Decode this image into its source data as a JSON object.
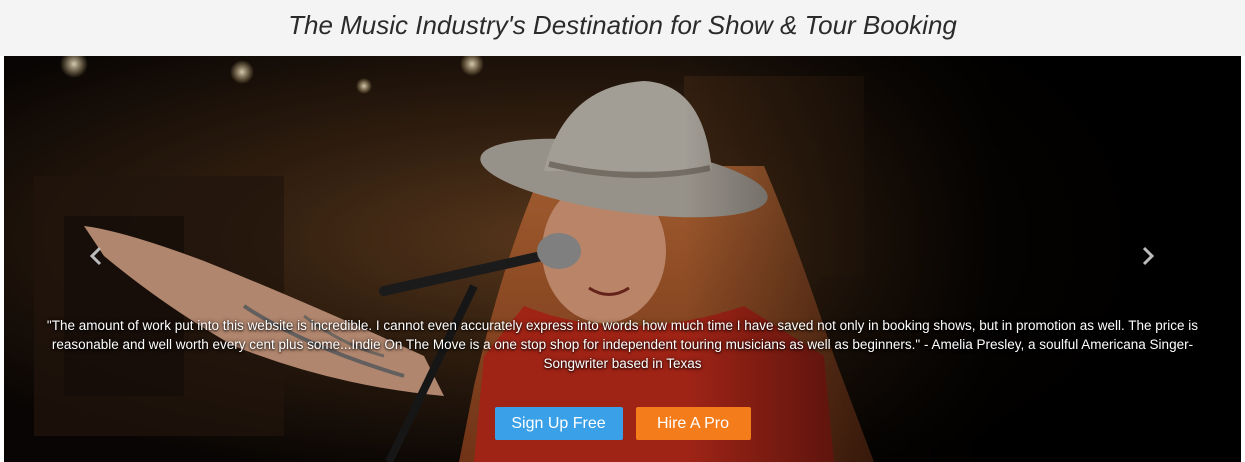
{
  "header": {
    "title": "The Music Industry's Destination for Show & Tour Booking"
  },
  "carousel": {
    "prev_icon": "chevron-left-icon",
    "next_icon": "chevron-right-icon",
    "quote": "\"The amount of work put into this website is incredible. I cannot even accurately express into words how much time I have saved not only in booking shows, but in promotion as well. The price is reasonable and well worth every cent plus some...Indie On The Move is a one stop shop for independent touring musicians as well as beginners.\" - Amelia Presley, a soulful Americana Singer-Songwriter based in Texas"
  },
  "cta": {
    "signup_label": "Sign Up Free",
    "hire_label": "Hire A Pro"
  },
  "colors": {
    "signup": "#3aa0e8",
    "hire": "#f57c1a",
    "header_bg": "#f4f4f4"
  }
}
